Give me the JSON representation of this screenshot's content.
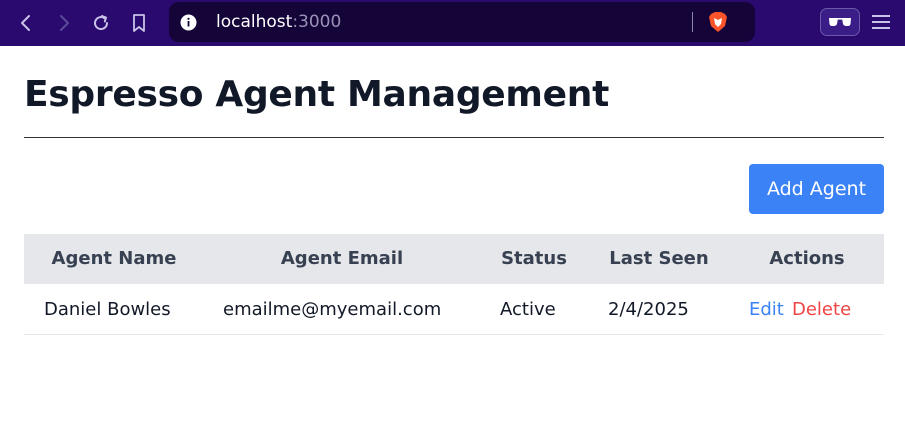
{
  "browser": {
    "url_host": "localhost",
    "url_port": ":3000",
    "icons": [
      "back-icon",
      "forward-icon",
      "reload-icon",
      "bookmark-icon",
      "site-info-icon",
      "brave-shield-icon",
      "reader-mode-icon",
      "menu-icon"
    ],
    "bar_color": "#2a0a6e"
  },
  "page": {
    "title": "Espresso Agent Management",
    "add_button_label": "Add Agent",
    "accent_color": "#3b82f6"
  },
  "table": {
    "headers": [
      "Agent Name",
      "Agent Email",
      "Status",
      "Last Seen",
      "Actions"
    ],
    "rows": [
      {
        "name": "Daniel Bowles",
        "email": "emailme@myemail.com",
        "status": "Active",
        "last_seen": "2/4/2025",
        "edit_label": "Edit",
        "delete_label": "Delete"
      }
    ]
  }
}
